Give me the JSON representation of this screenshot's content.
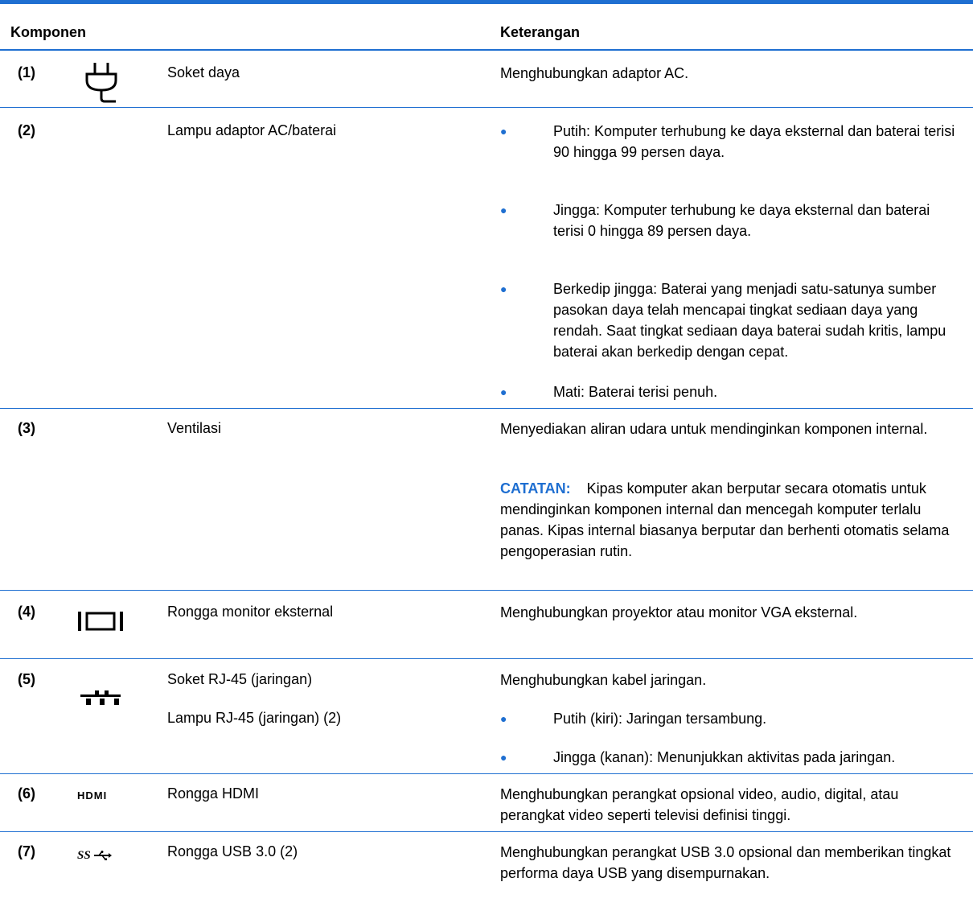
{
  "header": {
    "component": "Komponen",
    "description": "Keterangan"
  },
  "rows": [
    {
      "num": "(1)",
      "icon": "power-plug-icon",
      "name": "Soket daya",
      "desc": "Menghubungkan adaptor AC."
    },
    {
      "num": "(2)",
      "name": "Lampu adaptor AC/baterai",
      "bullets": [
        "Putih: Komputer terhubung ke daya eksternal dan baterai terisi 90 hingga 99 persen daya.",
        "Jingga: Komputer terhubung ke daya eksternal dan baterai terisi 0 hingga 89 persen daya.",
        "Berkedip jingga: Baterai yang menjadi satu-satunya sumber pasokan daya telah mencapai tingkat sediaan daya yang rendah. Saat tingkat sediaan daya baterai sudah kritis, lampu baterai akan berkedip dengan cepat.",
        "Mati: Baterai terisi penuh."
      ]
    },
    {
      "num": "(3)",
      "name": "Ventilasi",
      "desc": "Menyediakan aliran udara untuk mendinginkan komponen internal.",
      "note_label": "CATATAN:",
      "note": "Kipas komputer akan berputar secara otomatis untuk mendinginkan komponen internal dan mencegah komputer terlalu panas. Kipas internal biasanya berputar dan berhenti otomatis selama pengoperasian rutin."
    },
    {
      "num": "(4)",
      "icon": "external-monitor-port-icon",
      "name": "Rongga monitor eksternal",
      "desc": "Menghubungkan proyektor atau monitor VGA eksternal."
    },
    {
      "num": "(5)",
      "icon": "network-jack-icon",
      "name": "Soket RJ-45 (jaringan)",
      "name2": "Lampu RJ-45 (jaringan) (2)",
      "desc": "Menghubungkan kabel jaringan.",
      "bullets": [
        "Putih (kiri): Jaringan tersambung.",
        "Jingga (kanan): Menunjukkan aktivitas pada jaringan."
      ]
    },
    {
      "num": "(6)",
      "icon": "hdmi-port-icon",
      "icon_text": "HDMI",
      "name": "Rongga HDMI",
      "desc": "Menghubungkan perangkat opsional video, audio, digital, atau perangkat video seperti televisi definisi tinggi."
    },
    {
      "num": "(7)",
      "icon": "usb-3-icon",
      "icon_text": "SS",
      "name": "Rongga USB 3.0 (2)",
      "desc": "Menghubungkan perangkat USB 3.0 opsional dan memberikan tingkat performa daya USB yang disempurnakan."
    }
  ],
  "colors": {
    "accent": "#1f6fd1"
  }
}
